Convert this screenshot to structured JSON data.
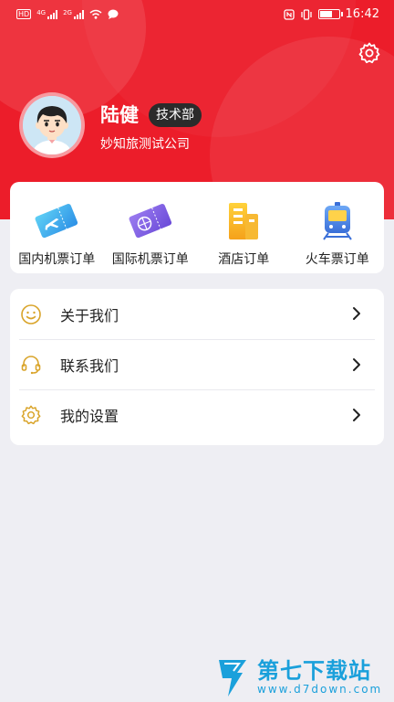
{
  "status_bar": {
    "time": "16:42",
    "net1": "4G",
    "net2": "2G"
  },
  "profile": {
    "name": "陆健",
    "department": "技术部",
    "company": "妙知旅测试公司"
  },
  "orders": [
    {
      "label": "国内机票订单",
      "icon": "domestic-flight-ticket-icon"
    },
    {
      "label": "国际机票订单",
      "icon": "international-flight-ticket-icon"
    },
    {
      "label": "酒店订单",
      "icon": "hotel-icon"
    },
    {
      "label": "火车票订单",
      "icon": "train-icon"
    }
  ],
  "menu": [
    {
      "label": "关于我们",
      "icon": "smile-icon"
    },
    {
      "label": "联系我们",
      "icon": "headset-icon"
    },
    {
      "label": "我的设置",
      "icon": "gear-icon"
    }
  ],
  "watermark": {
    "title": "第七下载站",
    "url": "www.d7down.com"
  },
  "colors": {
    "header": "#ec1d2a",
    "background": "#eeeef3",
    "badge": "#2b2b2b",
    "menu_icon": "#d9a42a"
  }
}
